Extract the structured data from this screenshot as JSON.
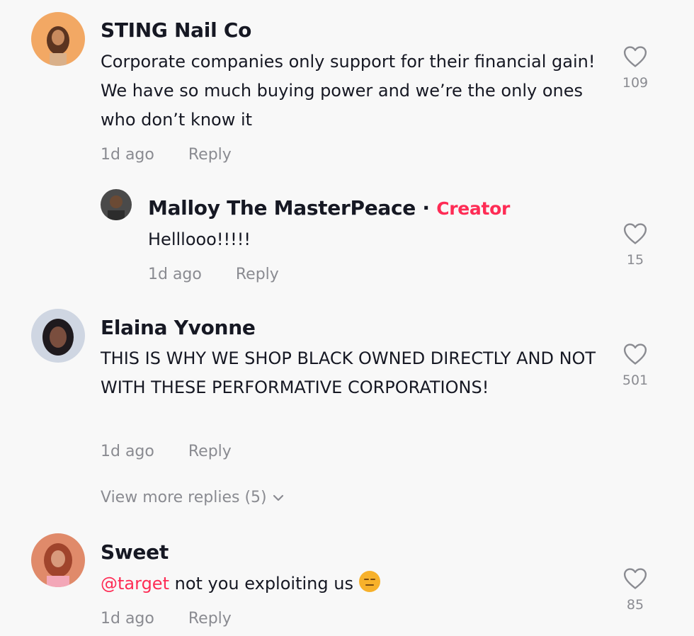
{
  "comments": [
    {
      "author": "STING Nail Co",
      "text": "Corporate companies only support for their financial gain! We have so much buying power and we’re the only ones who don’t know it",
      "time": "1d ago",
      "reply_label": "Reply",
      "likes": "109"
    },
    {
      "author": "Malloy The MasterPeace",
      "badge_separator": " · ",
      "badge": "Creator",
      "text": "Helllooo!!!!!",
      "time": "1d ago",
      "reply_label": "Reply",
      "likes": "15"
    },
    {
      "author": "Elaina Yvonne",
      "text": "THIS IS WHY WE SHOP BLACK OWNED DIRECTLY AND NOT WITH THESE PERFORMATIVE CORPORATIONS!",
      "time": "1d ago",
      "reply_label": "Reply",
      "likes": "501"
    },
    {
      "author": "Sweet",
      "mention": "@target",
      "text": " not you exploiting us",
      "emoji": "expressionless-face-emoji",
      "time": "1d ago",
      "reply_label": "Reply",
      "likes": "85"
    }
  ],
  "view_more_replies": "View more replies (5)",
  "icons": {
    "like": "heart-outline-icon",
    "expand": "chevron-down-icon"
  },
  "colors": {
    "background": "#f8f8f8",
    "text": "#161823",
    "muted": "#8a8b91",
    "accent": "#fe2c55"
  }
}
